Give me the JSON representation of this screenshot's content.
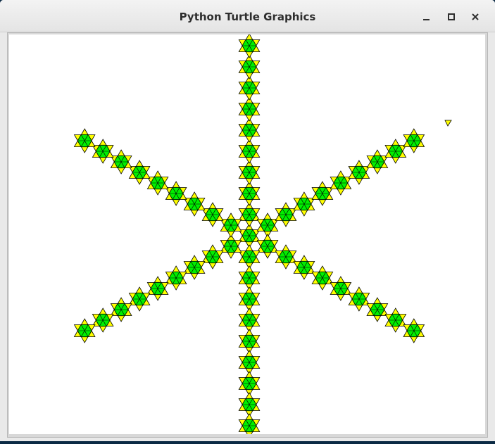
{
  "window": {
    "title": "Python Turtle Graphics",
    "controls": [
      "minimize-icon",
      "maximize-icon",
      "close-icon"
    ]
  },
  "drawing": {
    "description_shape": "six-armed snowflake of hexagram stars",
    "arms": 6,
    "fill_outer": "#ffff00",
    "fill_inner": "#00ee00",
    "stroke": "#000000",
    "background": "#ffffff",
    "turtle_cursor": "arrow-icon"
  }
}
